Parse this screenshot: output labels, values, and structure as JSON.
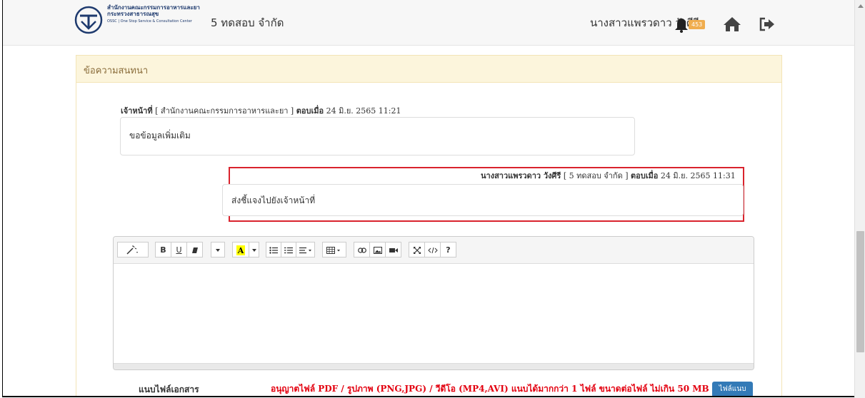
{
  "header": {
    "logo_line1": "สำนักงานคณะกรรมการอาหารและยา",
    "logo_line2": "กระทรวงสาธารณสุข",
    "logo_line3": "OSSC | One Stop Service & Consultation Center",
    "company": "5 ทดสอบ จำกัด",
    "username": "นางสาวแพรวดาว วังศีรี",
    "notification_count": "453"
  },
  "panel": {
    "title": "ข้อความสนทนา"
  },
  "messages": [
    {
      "role": "เจ้าหน้าที่",
      "org": " [ สำนักงานคณะกรรมการอาหารและยา ] ",
      "reply_label": "ตอบเมื่อ",
      "datetime": " 24 มิ.ย. 2565 11:21",
      "text": "ขอข้อมูลเพิ่มเติม"
    },
    {
      "role": "นางสาวแพรวดาว วังศีรี",
      "org": " [ 5 ทดสอบ จำกัด ] ",
      "reply_label": "ตอบเมื่อ",
      "datetime": " 24 มิ.ย. 2565 11:31",
      "text": "ส่งชี้แจงไปยังเจ้าหน้าที่"
    }
  ],
  "editor": {
    "toolbar": {
      "bold": "B",
      "underline": "U",
      "help": "?"
    },
    "content": ""
  },
  "attachment": {
    "label": "แนบไฟล์เอกสาร",
    "note": "อนุญาตไฟล์ PDF / รูปภาพ (PNG,JPG) / วีดีโอ (MP4,AVI) แนบได้มากกว่า 1 ไฟล์ ขนาดต่อไฟล์ ไม่เกิน 50 MB",
    "button": "ไฟล์แนบ"
  },
  "colors": {
    "panel_header_bg": "#fcf5dc",
    "highlight_border": "#d9232d",
    "note_red": "#e3000f",
    "badge": "#f0ad4e",
    "button_blue": "#337ab7"
  }
}
